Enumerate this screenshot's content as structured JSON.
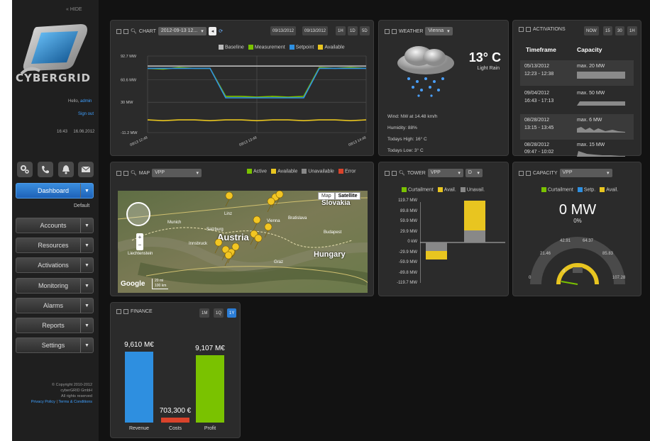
{
  "sidebar": {
    "hide_label": "« HIDE",
    "logo_text": "CYBERGRID",
    "greeting": "Hello,",
    "username": "admin",
    "signout": "Sign out",
    "time": "16:43",
    "date": "16.06.2012",
    "nav": [
      {
        "label": "Dashboard",
        "active": true
      },
      {
        "label": "Resources"
      },
      {
        "label": "Activations"
      },
      {
        "label": "Monitoring"
      },
      {
        "label": "Alarms"
      },
      {
        "label": "Reports"
      },
      {
        "label": "Settings"
      }
    ],
    "extra_nav": {
      "label": "Accounts"
    },
    "default_label": "Default",
    "copyright": [
      "© Copyright 2010-2012",
      "cyberGRID GmbH",
      "All rights reserved"
    ],
    "privacy": "Privacy Policy",
    "terms": "Terms & Conditions"
  },
  "chart_panel": {
    "title": "CHART",
    "date_select": "2012-09-13 12...",
    "range_from": "09/13/2012",
    "range_to": "09/13/2012",
    "buttons": [
      "1H",
      "1D",
      "5D"
    ],
    "legend": [
      {
        "name": "Baseline",
        "color": "#bbbbbb"
      },
      {
        "name": "Measurement",
        "color": "#7ac200"
      },
      {
        "name": "Setpoint",
        "color": "#2e8fe0"
      },
      {
        "name": "Available",
        "color": "#e8c520"
      }
    ]
  },
  "chart_data": {
    "type": "line",
    "y_ticks": [
      "92.7 MW",
      "60.6 MW",
      "30 MW",
      "-11.2 MW"
    ],
    "x_ticks": [
      "09/13 12:48",
      "09/13 13:48",
      "09/13 14:48"
    ],
    "series": [
      {
        "name": "Baseline",
        "color": "#bbbbbb",
        "values": [
          79,
          79,
          79,
          79,
          79,
          79,
          79,
          79,
          79,
          79,
          79,
          79,
          79,
          79,
          79
        ]
      },
      {
        "name": "Measurement",
        "color": "#7ac200",
        "values": [
          76,
          75,
          77,
          76,
          76,
          38,
          38,
          37,
          38,
          37,
          38,
          77,
          76,
          77,
          76
        ]
      },
      {
        "name": "Setpoint",
        "color": "#2e8fe0",
        "values": [
          76,
          76,
          76,
          76,
          76,
          36,
          36,
          36,
          36,
          36,
          36,
          76,
          76,
          76,
          76
        ]
      },
      {
        "name": "Available",
        "color": "#e8c520",
        "values": [
          6,
          5,
          6,
          6,
          5,
          6,
          6,
          5,
          6,
          6,
          5,
          6,
          6,
          5,
          6
        ]
      }
    ],
    "ylim": [
      -11.2,
      92.7
    ]
  },
  "weather": {
    "title": "WEATHER",
    "city": "Vienna",
    "temperature": "13° C",
    "condition": "Light Rain",
    "wind": "Wind: NW at 14.48 km/h",
    "humidity": "Humidity: 88%",
    "high": "Todays High: 16° C",
    "low": "Todays Low: 3° C"
  },
  "activations": {
    "title": "ACTIVATIONS",
    "buttons": [
      "NOW",
      "15",
      "30",
      "1H"
    ],
    "col_timeframe": "Timeframe",
    "col_capacity": "Capacity",
    "rows": [
      {
        "date": "05/13/2012",
        "time": "12:23 - 12:38",
        "cap": "max. 20 MW"
      },
      {
        "date": "09/04/2012",
        "time": "16:43 - 17:13",
        "cap": "max. 50 MW"
      },
      {
        "date": "08/28/2012",
        "time": "13:15 - 13:45",
        "cap": "max. 6 MW"
      },
      {
        "date": "08/28/2012",
        "time": "09:47 - 10:02",
        "cap": "max. 15 MW"
      }
    ]
  },
  "map": {
    "title": "MAP",
    "select": "VPP",
    "legend": [
      {
        "name": "Active",
        "color": "#7ac200"
      },
      {
        "name": "Available",
        "color": "#e8c520"
      },
      {
        "name": "Unavailable",
        "color": "#888888"
      },
      {
        "name": "Error",
        "color": "#d9432b"
      }
    ],
    "map_btn": "Map",
    "sat_btn": "Satellite",
    "labels": [
      "Austria",
      "Hungary",
      "Slovakia",
      "Vienna",
      "Linz",
      "Munich",
      "Graz",
      "Liechtenstein",
      "Budapest",
      "Bratislava",
      "Innsbruck",
      "Salzburg"
    ],
    "scale1": "100 km",
    "scale2": "20 mi",
    "google": "Google"
  },
  "tower": {
    "title": "TOWER",
    "select": "VPP",
    "select2": "D",
    "legend": [
      {
        "name": "Curtailment",
        "color": "#7ac200"
      },
      {
        "name": "Avail.",
        "color": "#e8c520"
      },
      {
        "name": "Unavail.",
        "color": "#888888"
      }
    ],
    "y_ticks": [
      "119.7 MW",
      "89.8 MW",
      "59.9 MW",
      "29.9 MW",
      "0 kW",
      "-29.9 MW",
      "-59.9 MW",
      "-89.8 MW",
      "-119.7 MW"
    ]
  },
  "capacity": {
    "title": "CAPACITY",
    "select": "VPP",
    "legend": [
      {
        "name": "Curtailment",
        "color": "#7ac200"
      },
      {
        "name": "Setp.",
        "color": "#2e8fe0"
      },
      {
        "name": "Avail.",
        "color": "#e8c520"
      }
    ],
    "value": "0 MW",
    "percent": "0%",
    "gauge_ticks": [
      "0",
      "21.46",
      "42.91",
      "64.37",
      "85.83",
      "107.28"
    ],
    "gauge_center": "0"
  },
  "finance": {
    "title": "FINANCE",
    "buttons": [
      "1M",
      "1Q",
      "1Y"
    ],
    "bars": [
      {
        "label": "Revenue",
        "value_label": "9,610 M€",
        "color": "#2e8fe0",
        "value": 9610
      },
      {
        "label": "Costs",
        "value_label": "703,300 €",
        "color": "#d9432b",
        "value": 703
      },
      {
        "label": "Profit",
        "value_label": "9,107 M€",
        "color": "#7ac200",
        "value": 9107
      }
    ]
  }
}
